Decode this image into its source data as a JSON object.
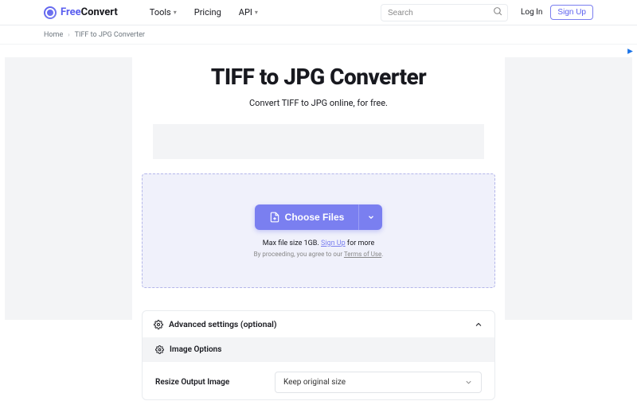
{
  "logo": {
    "part1": "Free",
    "part2": "Convert"
  },
  "nav": {
    "tools": "Tools",
    "pricing": "Pricing",
    "api": "API"
  },
  "search": {
    "placeholder": "Search"
  },
  "auth": {
    "login": "Log In",
    "signup": "Sign Up"
  },
  "breadcrumb": {
    "home": "Home",
    "current": "TIFF to JPG Converter"
  },
  "page": {
    "title": "TIFF to JPG Converter",
    "subtitle": "Convert TIFF to JPG online, for free."
  },
  "dropzone": {
    "choose": "Choose Files",
    "max_prefix": "Max file size 1GB. ",
    "max_link": "Sign Up",
    "max_suffix": " for more",
    "terms_prefix": "By proceeding, you agree to our ",
    "terms_link": "Terms of Use",
    "terms_suffix": "."
  },
  "advanced": {
    "heading": "Advanced settings (optional)",
    "image_options": "Image Options",
    "resize_label": "Resize Output Image",
    "resize_value": "Keep original size"
  }
}
